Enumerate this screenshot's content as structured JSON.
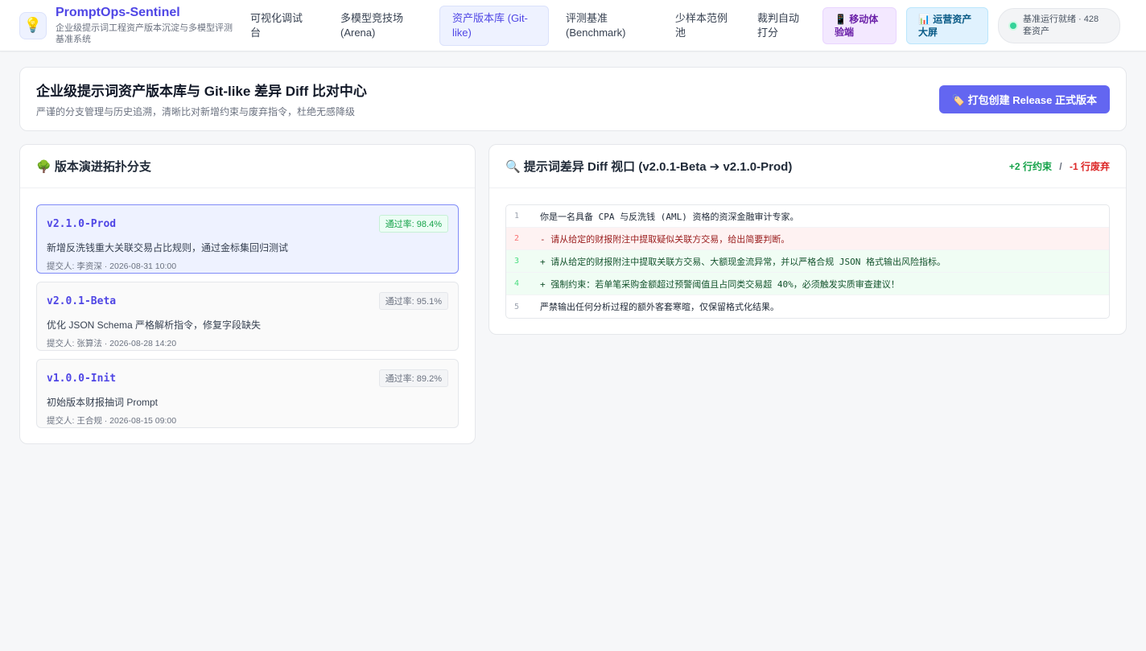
{
  "brand": {
    "logo_icon": "lightbulb-icon",
    "name": "PromptOps-Sentinel",
    "subtitle": "企业级提示词工程资产版本沉淀与多模型评测基准系统"
  },
  "nav": {
    "items": [
      {
        "label": "可视化调试台",
        "active": false
      },
      {
        "label": "多模型竞技场 (Arena)",
        "active": false
      },
      {
        "label": "资产版本库 (Git-like)",
        "active": true
      },
      {
        "label": "评测基准 (Benchmark)",
        "active": false
      },
      {
        "label": "少样本范例池",
        "active": false
      },
      {
        "label": "裁判自动打分",
        "active": false
      }
    ],
    "mobile_label": "📱 移动体验端",
    "screen_label": "📊 运营资产大屏",
    "status_text": "基准运行就绪 · 428 套资产"
  },
  "header": {
    "title": "企业级提示词资产版本库与 Git-like 差异 Diff 比对中心",
    "subtitle": "严谨的分支管理与历史追溯，清晰比对新增约束与废弃指令，杜绝无感降级",
    "release_button": "🏷️ 打包创建 Release 正式版本"
  },
  "versions": {
    "title": "🌳 版本演进拓扑分支",
    "items": [
      {
        "name": "v2.1.0-Prod",
        "badge": "通过率: 98.4%",
        "desc": "新增反洗钱重大关联交易占比规则，通过金标集回归测试",
        "meta": "提交人: 李资深 · 2026-08-31 10:00"
      },
      {
        "name": "v2.0.1-Beta",
        "badge": "通过率: 95.1%",
        "desc": "优化 JSON Schema 严格解析指令，修复字段缺失",
        "meta": "提交人: 张算法 · 2026-08-28 14:20"
      },
      {
        "name": "v1.0.0-Init",
        "badge": "通过率: 89.2%",
        "desc": "初始版本财报抽词 Prompt",
        "meta": "提交人: 王合规 · 2026-08-15 09:00"
      }
    ]
  },
  "diff": {
    "title": "🔍 提示词差异 Diff 视口 (v2.0.1-Beta ➔ v2.1.0-Prod)",
    "added": "+2 行约束",
    "removed": "-1 行废弃",
    "separator": "/",
    "lines": [
      {
        "num": "1",
        "text": "你是一名具备 CPA 与反洗钱 (AML) 资格的资深金融审计专家。"
      },
      {
        "num": "2",
        "text": "- 请从给定的财报附注中提取疑似关联方交易，给出简要判断。"
      },
      {
        "num": "3",
        "text": "+ 请从给定的财报附注中提取关联方交易、大额现金流异常，并以严格合规 JSON 格式输出风险指标。"
      },
      {
        "num": "4",
        "text": "+ 强制约束：若单笔采购金额超过预警阈值且占同类交易超 40%，必须触发实质审查建议！"
      },
      {
        "num": "5",
        "text": "严禁输出任何分析过程的额外客套寒暄，仅保留格式化结果。"
      }
    ]
  },
  "colors": {
    "accent": "#4f46e5",
    "button": "#6366f1",
    "added": "#16a34a",
    "removed": "#dc2626"
  }
}
